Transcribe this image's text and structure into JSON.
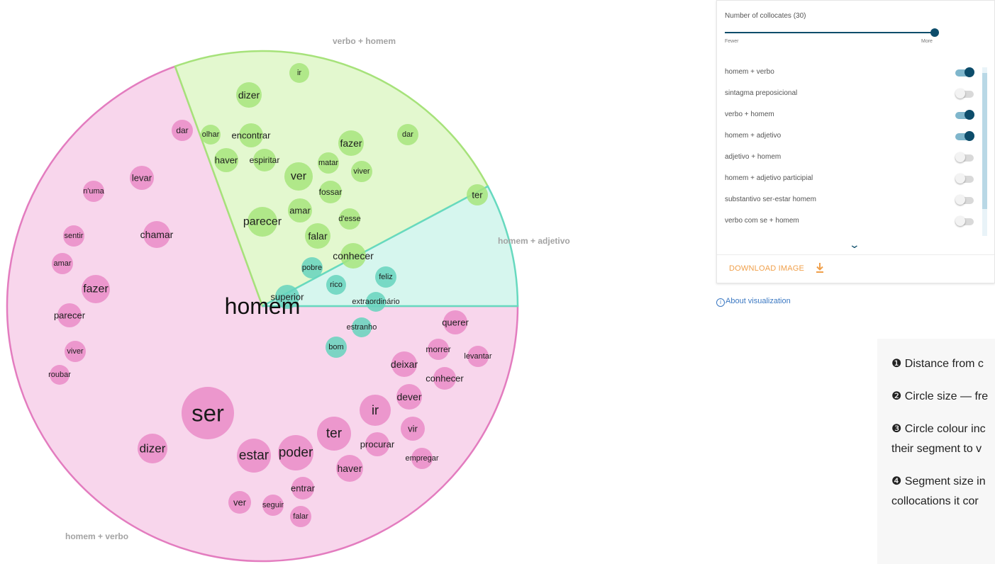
{
  "center_word": "homem",
  "segments": [
    {
      "name": "homem + verbo",
      "fill": "#f8d6ec",
      "stroke": "#e37cbf"
    },
    {
      "name": "verbo + homem",
      "fill": "#e3f8cf",
      "stroke": "#a6e27a"
    },
    {
      "name": "homem + adjetivo",
      "fill": "#d6f6ee",
      "stroke": "#67d9bf"
    }
  ],
  "collocates": {
    "homem_verbo": [
      "ser",
      "estar",
      "poder",
      "ter",
      "ir",
      "dizer",
      "querer",
      "morrer",
      "levantar",
      "deixar",
      "conhecer",
      "dever",
      "vir",
      "procurar",
      "empregar",
      "haver",
      "entrar",
      "ver",
      "seguir",
      "falar",
      "dar",
      "levar",
      "n'uma",
      "chamar",
      "sentir",
      "amar",
      "fazer",
      "parecer",
      "viver",
      "roubar"
    ],
    "verbo_homem": [
      "ir",
      "dizer",
      "olhar",
      "encontrar",
      "haver",
      "espiritar",
      "ver",
      "matar",
      "viver",
      "fazer",
      "dar",
      "fossar",
      "amar",
      "d'esse",
      "parecer",
      "falar",
      "conhecer",
      "ter"
    ],
    "homem_adjetivo": [
      "pobre",
      "rico",
      "feliz",
      "superior",
      "extraordinário",
      "estranho",
      "bom"
    ]
  },
  "colors": {
    "homem_verbo": "#ea8cc8",
    "verbo_homem": "#a7e57d",
    "homem_adjetivo": "#66d3bd"
  },
  "panel": {
    "slider_title": "Number of collocates (30)",
    "slider_min": "Fewer",
    "slider_max": "More",
    "slider_level": 1.0,
    "toggles": [
      {
        "label": "homem + verbo",
        "on": true
      },
      {
        "label": "sintagma preposicional",
        "on": false
      },
      {
        "label": "verbo + homem",
        "on": true
      },
      {
        "label": "homem + adjetivo",
        "on": true
      },
      {
        "label": "adjetivo + homem",
        "on": false
      },
      {
        "label": "homem + adjetivo participial",
        "on": false
      },
      {
        "label": "substantivo ser-estar homem",
        "on": false
      },
      {
        "label": "verbo com se + homem",
        "on": false
      }
    ],
    "download_label": "DOWNLOAD IMAGE",
    "about_label": "About visualization"
  },
  "legend": [
    "❶ Distance from c",
    "❷ Circle size — fre",
    "❸ Circle colour inc",
    "their segment to v",
    "❹ Segment size in",
    "collocations it cor"
  ]
}
